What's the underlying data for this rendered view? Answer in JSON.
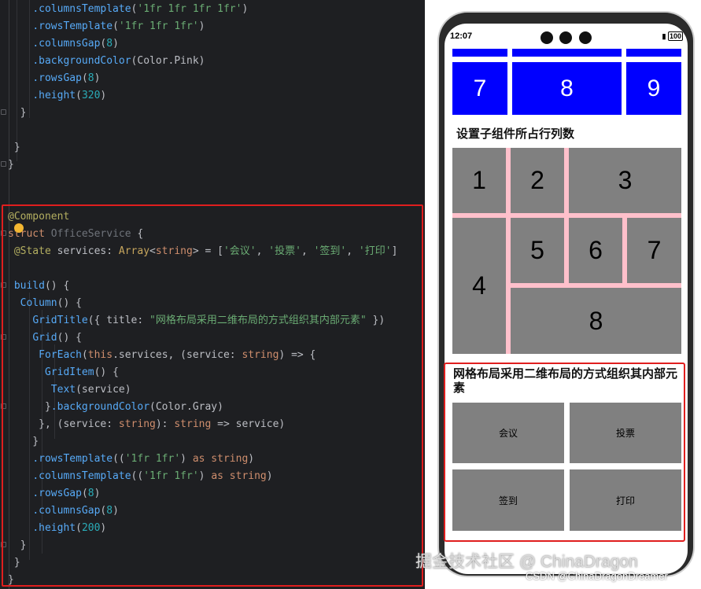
{
  "editor": {
    "lines": [
      [
        {
          "c": "t-plain",
          "t": "    "
        },
        {
          "c": "t-fn",
          "t": ".columnsTemplate"
        },
        {
          "c": "t-plain",
          "t": "("
        },
        {
          "c": "t-str",
          "t": "'1fr 1fr 1fr 1fr'"
        },
        {
          "c": "t-plain",
          "t": ")"
        }
      ],
      [
        {
          "c": "t-plain",
          "t": "    "
        },
        {
          "c": "t-fn",
          "t": ".rowsTemplate"
        },
        {
          "c": "t-plain",
          "t": "("
        },
        {
          "c": "t-str",
          "t": "'1fr 1fr 1fr'"
        },
        {
          "c": "t-plain",
          "t": ")"
        }
      ],
      [
        {
          "c": "t-plain",
          "t": "    "
        },
        {
          "c": "t-fn",
          "t": ".columnsGap"
        },
        {
          "c": "t-plain",
          "t": "("
        },
        {
          "c": "t-num",
          "t": "8"
        },
        {
          "c": "t-plain",
          "t": ")"
        }
      ],
      [
        {
          "c": "t-plain",
          "t": "    "
        },
        {
          "c": "t-fn",
          "t": ".backgroundColor"
        },
        {
          "c": "t-plain",
          "t": "(Color.Pink)"
        }
      ],
      [
        {
          "c": "t-plain",
          "t": "    "
        },
        {
          "c": "t-fn",
          "t": ".rowsGap"
        },
        {
          "c": "t-plain",
          "t": "("
        },
        {
          "c": "t-num",
          "t": "8"
        },
        {
          "c": "t-plain",
          "t": ")"
        }
      ],
      [
        {
          "c": "t-plain",
          "t": "    "
        },
        {
          "c": "t-fn",
          "t": ".height"
        },
        {
          "c": "t-plain",
          "t": "("
        },
        {
          "c": "t-num",
          "t": "320"
        },
        {
          "c": "t-plain",
          "t": ")"
        }
      ],
      [
        {
          "c": "t-plain",
          "t": "  }"
        }
      ],
      [],
      [
        {
          "c": "t-plain",
          "t": " }"
        }
      ],
      [
        {
          "c": "t-plain",
          "t": "}"
        }
      ],
      [],
      [],
      [
        {
          "c": "t-ann",
          "t": "@Component"
        }
      ],
      [
        {
          "c": "t-kw",
          "t": "struct "
        },
        {
          "c": "t-muted",
          "t": "OfficeService"
        },
        {
          "c": "t-plain",
          "t": " {"
        }
      ],
      [
        {
          "c": "t-plain",
          "t": " "
        },
        {
          "c": "t-ann",
          "t": "@State"
        },
        {
          "c": "t-plain",
          "t": " services: "
        },
        {
          "c": "t-cls",
          "t": "Array"
        },
        {
          "c": "t-plain",
          "t": "<"
        },
        {
          "c": "t-kw",
          "t": "string"
        },
        {
          "c": "t-plain",
          "t": "> = ["
        },
        {
          "c": "t-str",
          "t": "'会议'"
        },
        {
          "c": "t-plain",
          "t": ", "
        },
        {
          "c": "t-str",
          "t": "'投票'"
        },
        {
          "c": "t-plain",
          "t": ", "
        },
        {
          "c": "t-str",
          "t": "'签到'"
        },
        {
          "c": "t-plain",
          "t": ", "
        },
        {
          "c": "t-str",
          "t": "'打印'"
        },
        {
          "c": "t-plain",
          "t": "]"
        }
      ],
      [],
      [
        {
          "c": "t-plain",
          "t": " "
        },
        {
          "c": "t-fn",
          "t": "build"
        },
        {
          "c": "t-plain",
          "t": "() {"
        }
      ],
      [
        {
          "c": "t-plain",
          "t": "  "
        },
        {
          "c": "t-fn",
          "t": "Column"
        },
        {
          "c": "t-plain",
          "t": "() {"
        }
      ],
      [
        {
          "c": "t-plain",
          "t": "    "
        },
        {
          "c": "t-fn",
          "t": "GridTitle"
        },
        {
          "c": "t-plain",
          "t": "({ title: "
        },
        {
          "c": "t-str",
          "t": "\"网格布局采用二维布局的方式组织其内部元素\""
        },
        {
          "c": "t-plain",
          "t": " })"
        }
      ],
      [
        {
          "c": "t-plain",
          "t": "    "
        },
        {
          "c": "t-fn",
          "t": "Grid"
        },
        {
          "c": "t-plain",
          "t": "() {"
        }
      ],
      [
        {
          "c": "t-plain",
          "t": "     "
        },
        {
          "c": "t-fn",
          "t": "ForEach"
        },
        {
          "c": "t-plain",
          "t": "("
        },
        {
          "c": "t-kw",
          "t": "this"
        },
        {
          "c": "t-plain",
          "t": ".services, (service: "
        },
        {
          "c": "t-kw",
          "t": "string"
        },
        {
          "c": "t-plain",
          "t": ") => {"
        }
      ],
      [
        {
          "c": "t-plain",
          "t": "      "
        },
        {
          "c": "t-fn",
          "t": "GridItem"
        },
        {
          "c": "t-plain",
          "t": "() {"
        }
      ],
      [
        {
          "c": "t-plain",
          "t": "       "
        },
        {
          "c": "t-fn",
          "t": "Text"
        },
        {
          "c": "t-plain",
          "t": "(service)"
        }
      ],
      [
        {
          "c": "t-plain",
          "t": "      }"
        },
        {
          "c": "t-fn",
          "t": ".backgroundColor"
        },
        {
          "c": "t-plain",
          "t": "(Color.Gray)"
        }
      ],
      [
        {
          "c": "t-plain",
          "t": "     }, (service: "
        },
        {
          "c": "t-kw",
          "t": "string"
        },
        {
          "c": "t-plain",
          "t": "): "
        },
        {
          "c": "t-kw",
          "t": "string"
        },
        {
          "c": "t-plain",
          "t": " => service)"
        }
      ],
      [
        {
          "c": "t-plain",
          "t": "    }"
        }
      ],
      [
        {
          "c": "t-plain",
          "t": "    "
        },
        {
          "c": "t-fn",
          "t": ".rowsTemplate"
        },
        {
          "c": "t-plain",
          "t": "(("
        },
        {
          "c": "t-str",
          "t": "'1fr 1fr'"
        },
        {
          "c": "t-plain",
          "t": ") "
        },
        {
          "c": "t-kw",
          "t": "as string"
        },
        {
          "c": "t-plain",
          "t": ")"
        }
      ],
      [
        {
          "c": "t-plain",
          "t": "    "
        },
        {
          "c": "t-fn",
          "t": ".columnsTemplate"
        },
        {
          "c": "t-plain",
          "t": "(("
        },
        {
          "c": "t-str",
          "t": "'1fr 1fr'"
        },
        {
          "c": "t-plain",
          "t": ") "
        },
        {
          "c": "t-kw",
          "t": "as string"
        },
        {
          "c": "t-plain",
          "t": ")"
        }
      ],
      [
        {
          "c": "t-plain",
          "t": "    "
        },
        {
          "c": "t-fn",
          "t": ".rowsGap"
        },
        {
          "c": "t-plain",
          "t": "("
        },
        {
          "c": "t-num",
          "t": "8"
        },
        {
          "c": "t-plain",
          "t": ")"
        }
      ],
      [
        {
          "c": "t-plain",
          "t": "    "
        },
        {
          "c": "t-fn",
          "t": ".columnsGap"
        },
        {
          "c": "t-plain",
          "t": "("
        },
        {
          "c": "t-num",
          "t": "8"
        },
        {
          "c": "t-plain",
          "t": ")"
        }
      ],
      [
        {
          "c": "t-plain",
          "t": "    "
        },
        {
          "c": "t-fn",
          "t": ".height"
        },
        {
          "c": "t-plain",
          "t": "("
        },
        {
          "c": "t-num",
          "t": "200"
        },
        {
          "c": "t-plain",
          "t": ")"
        }
      ],
      [
        {
          "c": "t-plain",
          "t": "  }"
        }
      ],
      [
        {
          "c": "t-plain",
          "t": " }"
        }
      ],
      [
        {
          "c": "t-plain",
          "t": "}"
        }
      ]
    ]
  },
  "phone": {
    "status": {
      "time": "12:07",
      "battery": "100"
    },
    "top_grid": [
      "7",
      "8",
      "9"
    ],
    "span_section_title": "设置子组件所占行列数",
    "span_grid": [
      "1",
      "2",
      "3",
      "4",
      "5",
      "6",
      "7",
      "8"
    ],
    "office_section_title": "网格布局采用二维布局的方式组织其内部元素",
    "office_grid": [
      "会议",
      "投票",
      "签到",
      "打印"
    ]
  },
  "watermarks": {
    "juejin": "掘金技术社区 @ ChinaDragon",
    "csdn": "CSDN @ChinaDragonDreamer"
  }
}
